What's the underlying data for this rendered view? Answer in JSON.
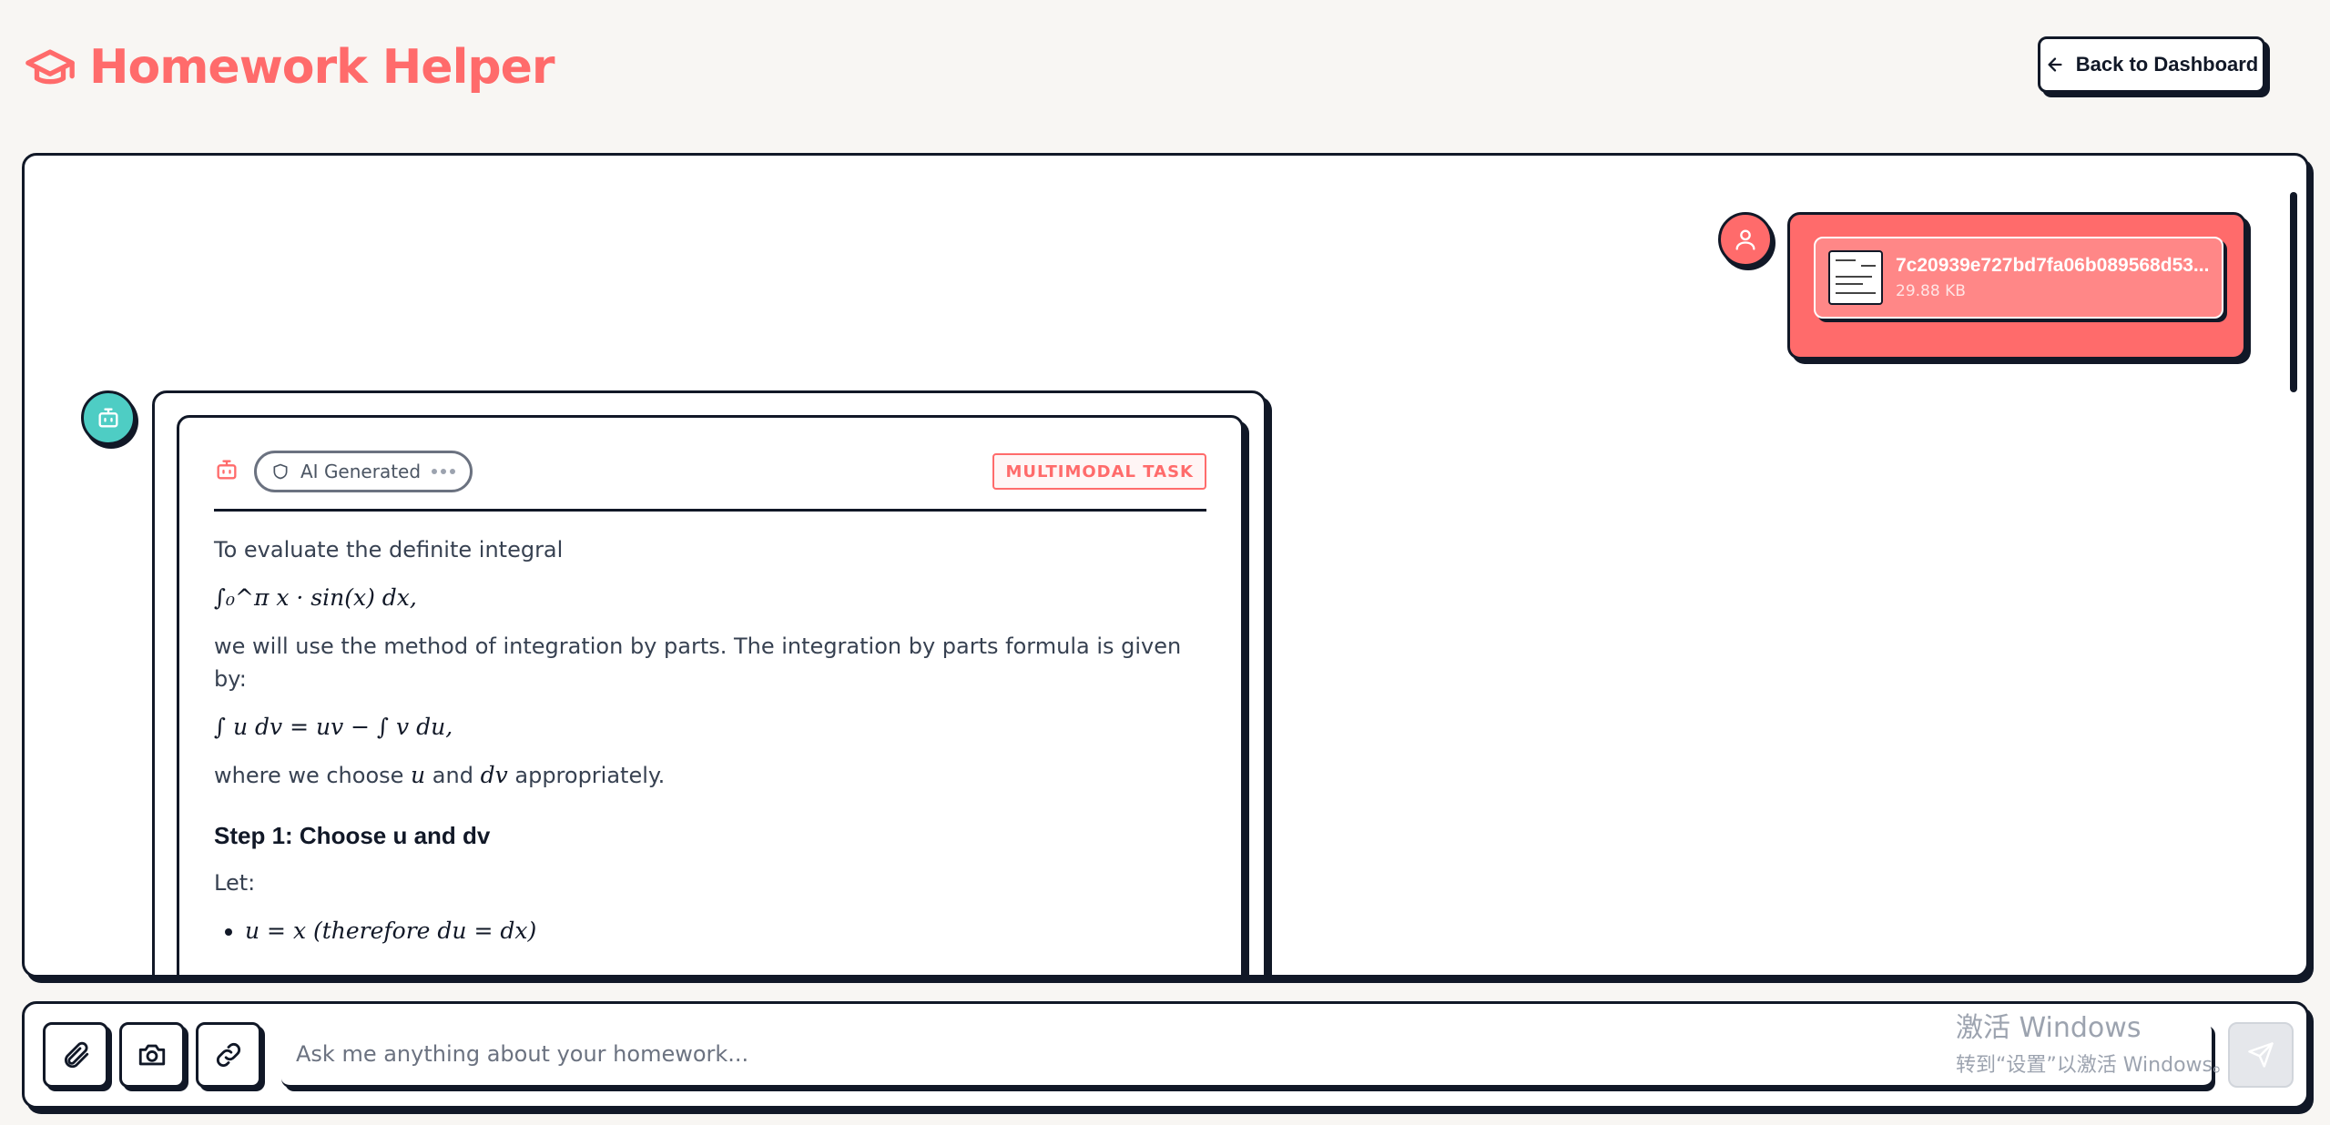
{
  "header": {
    "title": "Homework Helper",
    "back_label": "Back to Dashboard"
  },
  "user_message": {
    "file_name": "7c20939e727bd7fa06b089568d53...",
    "file_size": "29.88 KB"
  },
  "bot_message": {
    "badge_label": "AI Generated",
    "task_label": "MULTIMODAL TASK",
    "intro": "To evaluate the definite integral",
    "integral": "∫₀^π x · sin(x) dx,",
    "method": "we will use the method of integration by parts. The integration by parts formula is given by:",
    "formula": "∫ u dv = uv − ∫ v du,",
    "choose_pre": "where we choose",
    "choose_u": "u",
    "choose_and": "and",
    "choose_dv": "dv",
    "choose_post": "appropriately.",
    "step1_title": "Step 1: Choose u and dv",
    "let": "Let:",
    "bullet1": "u = x (therefore du = dx)"
  },
  "input": {
    "placeholder": "Ask me anything about your homework..."
  },
  "watermark": {
    "line1": "激活 Windows",
    "line2": "转到“设置”以激活 Windows。"
  },
  "colors": {
    "accent": "#ff6b6b",
    "bot": "#4ecdc4",
    "border": "#111827",
    "background": "#f8f6f3"
  }
}
